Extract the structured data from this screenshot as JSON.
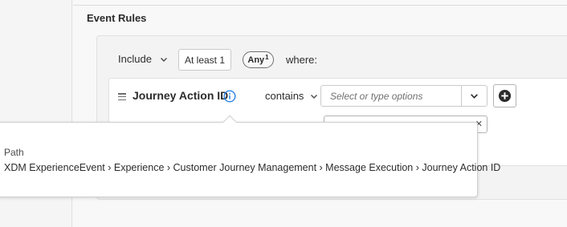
{
  "section": {
    "title": "Event Rules"
  },
  "rule_header": {
    "include_label": "Include",
    "at_least_label": "At least 1",
    "any_label": "Any",
    "any_superscript": "1",
    "where_label": "where:"
  },
  "condition": {
    "field_name": "Journey Action ID",
    "operator_label": "contains",
    "value_placeholder": "Select or type options"
  },
  "tooltip": {
    "label": "Path",
    "path": "XDM ExperienceEvent › Experience › Customer Journey Management › Message Execution › Journey Action ID"
  },
  "colors": {
    "info_icon": "#2680eb",
    "add_icon": "#2c2c2c"
  },
  "icons": {
    "drag": "drag-handle-icon",
    "info": "info-icon",
    "chevron": "chevron-down-icon",
    "add": "add-circle-icon",
    "close": "close-icon"
  }
}
